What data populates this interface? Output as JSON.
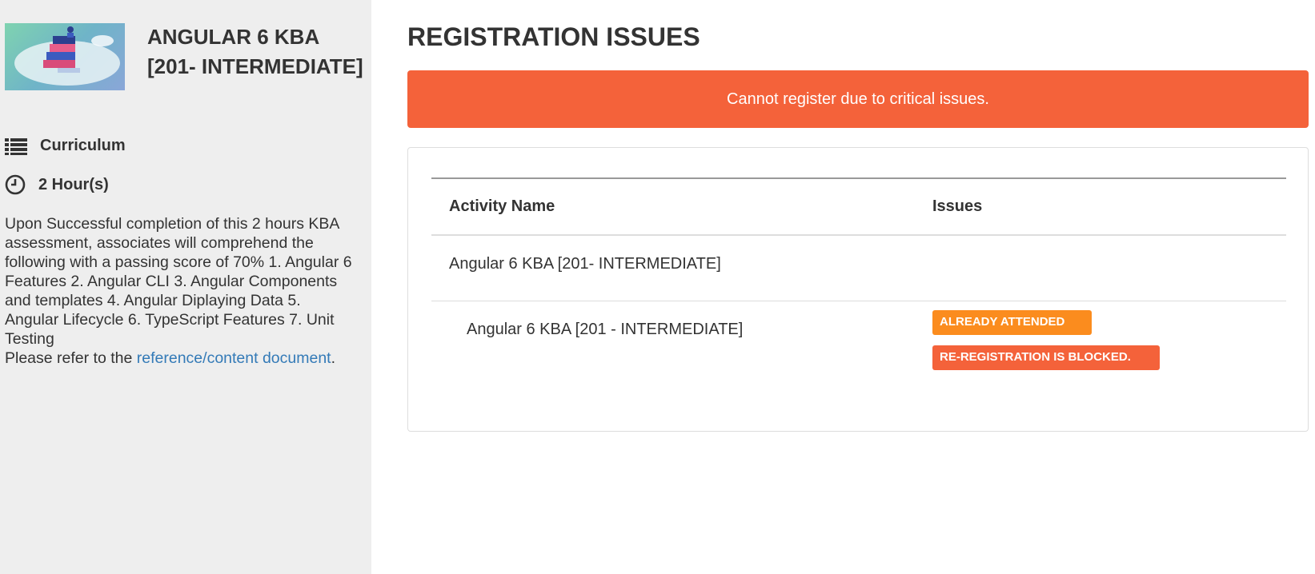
{
  "course": {
    "title": "ANGULAR 6 KBA [201- INTERMEDIATE]",
    "type_icon": "list-icon",
    "type_label": "Curriculum",
    "duration_icon": "clock-icon",
    "duration_label": "2 Hour(s)",
    "description": "Upon Successful completion of this 2 hours KBA assessment, associates will comprehend the following with a passing score of 70% 1. Angular 6 Features 2. Angular CLI 3. Angular Components and templates 4. Angular Diplaying Data 5. Angular Lifecycle 6. TypeScript Features 7. Unit Testing",
    "reference_prefix": "Please refer to the ",
    "reference_link": "reference/content document",
    "reference_suffix": "."
  },
  "page": {
    "title": "REGISTRATION ISSUES",
    "alert": "Cannot register due to critical issues."
  },
  "table": {
    "headers": {
      "activity": "Activity Name",
      "issues": "Issues"
    },
    "rows": [
      {
        "activity": "Angular 6 KBA [201- INTERMEDIATE]"
      },
      {
        "activity": "Angular 6 KBA [201 - INTERMEDIATE]",
        "badges": [
          "ALREADY ATTENDED",
          "RE-REGISTRATION IS BLOCKED."
        ]
      }
    ]
  },
  "colors": {
    "sidebar_bg": "#eeeeee",
    "alert_bg": "#f4623a",
    "warning_badge": "#fb8c1e",
    "danger_badge": "#f4623a",
    "link": "#337ab7"
  }
}
